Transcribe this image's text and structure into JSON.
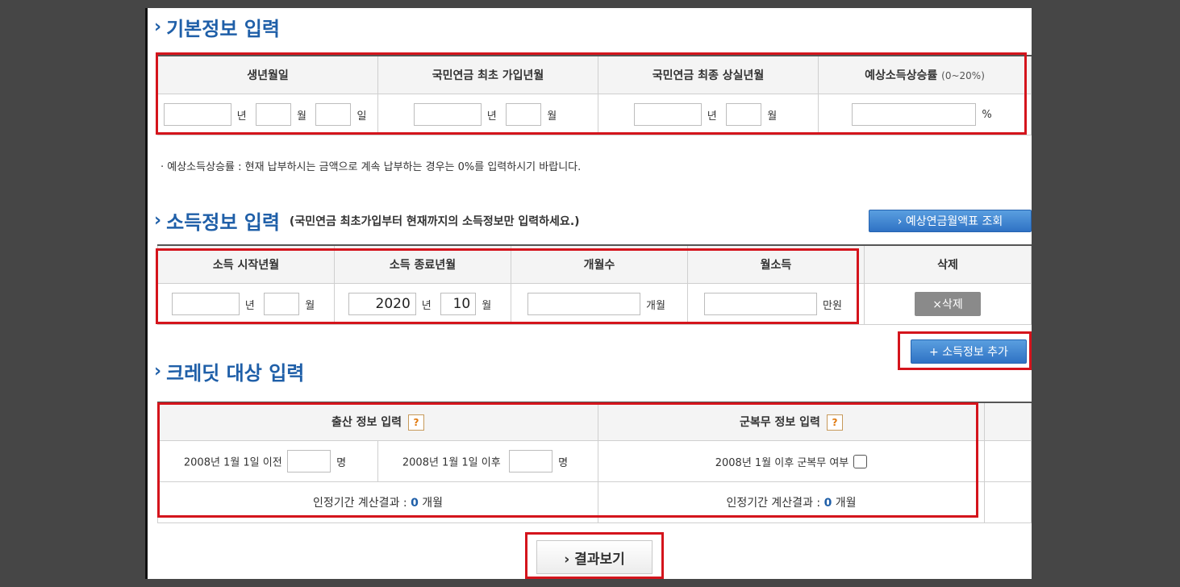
{
  "basic": {
    "title": "기본정보 입력",
    "headers": [
      "생년월일",
      "국민연금 최초 가입년월",
      "국민연금 최종 상실년월",
      "예상소득상승률"
    ],
    "rate_range": "(0~20%)",
    "units": {
      "year": "년",
      "month": "월",
      "day": "일",
      "percent": "%"
    },
    "note": "· 예상소득상승률 : 현재 납부하시는 금액으로 계속 납부하는 경우는 0%를 입력하시기 바랍니다."
  },
  "income": {
    "title": "소득정보 입력",
    "subtitle": "(국민연금 최초가입부터 현재까지의 소득정보만 입력하세요.)",
    "view_button": "› 예상연금월액표 조회",
    "headers": [
      "소득 시작년월",
      "소득 종료년월",
      "개월수",
      "월소득",
      "삭제"
    ],
    "end_year": "2020",
    "end_month": "10",
    "units": {
      "year": "년",
      "month": "월",
      "months": "개월",
      "man_won": "만원"
    },
    "delete_button": "×삭제",
    "add_button": "+ 소득정보 추가"
  },
  "credit": {
    "title": "크레딧 대상 입력",
    "birth_header": "출산 정보 입력",
    "military_header": "군복무 정보 입력",
    "help_glyph": "?",
    "before_label": "2008년 1월 1일 이전",
    "after_label": "2008년 1월 1일 이후",
    "person_unit": "명",
    "military_label": "2008년 1월 이후 군복무 여부",
    "result_label": "인정기간 계산결과 :",
    "birth_result": "0",
    "military_result": "0",
    "result_unit": "개월"
  },
  "result_button": "› 결과보기",
  "colors": {
    "accent": "#1f5fa8",
    "highlight": "#d4141c",
    "button_blue": "#2f72c4"
  }
}
